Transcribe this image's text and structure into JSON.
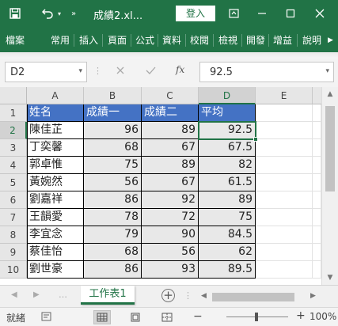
{
  "title_bar": {
    "filename": "成績2.xl...",
    "signin_label": "登入"
  },
  "ribbon": {
    "tabs": [
      "檔案",
      "常用",
      "插入",
      "頁面",
      "公式",
      "資料",
      "校閱",
      "檢視",
      "開發",
      "增益",
      "說明"
    ]
  },
  "formula_bar": {
    "name_box": "D2",
    "fx_label": "fx",
    "formula_value": "92.5"
  },
  "sheet": {
    "columns": [
      "A",
      "B",
      "C",
      "D",
      "E"
    ],
    "rows": [
      "1",
      "2",
      "3",
      "4",
      "5",
      "6",
      "7",
      "8",
      "9",
      "10"
    ],
    "header_row": [
      "姓名",
      "成績一",
      "成績二",
      "平均"
    ],
    "data": [
      [
        "陳佳芷",
        "96",
        "89",
        "92.5"
      ],
      [
        "丁奕馨",
        "68",
        "67",
        "67.5"
      ],
      [
        "郭卓惟",
        "75",
        "89",
        "82"
      ],
      [
        "黃婉然",
        "56",
        "67",
        "61.5"
      ],
      [
        "劉嘉祥",
        "86",
        "92",
        "89"
      ],
      [
        "王韻愛",
        "78",
        "72",
        "75"
      ],
      [
        "李宜念",
        "79",
        "90",
        "84.5"
      ],
      [
        "蔡佳怡",
        "68",
        "56",
        "62"
      ],
      [
        "劉世豪",
        "86",
        "93",
        "89.5"
      ]
    ],
    "active_cell": "D2"
  },
  "sheet_tabs": {
    "active_tab": "工作表1"
  },
  "status_bar": {
    "status": "就緒",
    "zoom": "100%"
  },
  "colors": {
    "accent": "#217346",
    "header_fill": "#4472c4",
    "number_fill": "#e8e8e8"
  }
}
